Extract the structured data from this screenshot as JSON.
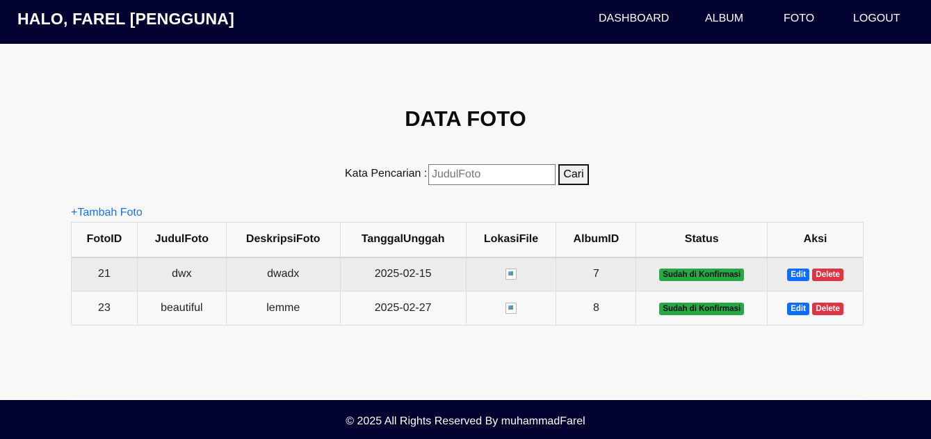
{
  "header": {
    "brand": "HALO, FAREL [PENGGUNA]",
    "nav": [
      {
        "label": "DASHBOARD"
      },
      {
        "label": "ALBUM"
      },
      {
        "label": "FOTO"
      },
      {
        "label": "LOGOUT"
      }
    ]
  },
  "main": {
    "title": "DATA FOTO",
    "search": {
      "label": "Kata Pencarian :",
      "placeholder": "JudulFoto",
      "value": "",
      "button": "Cari"
    },
    "add_link": "+Tambah Foto",
    "table": {
      "columns": [
        "FotoID",
        "JudulFoto",
        "DeskripsiFoto",
        "TanggalUnggah",
        "LokasiFile",
        "AlbumID",
        "Status",
        "Aksi"
      ],
      "rows": [
        {
          "fotoid": "21",
          "judul": "dwx",
          "deskripsi": "dwadx",
          "tanggal": "2025-02-15",
          "albumid": "7",
          "status": "Sudah di Konfirmasi",
          "edit": "Edit",
          "delete": "Delete"
        },
        {
          "fotoid": "23",
          "judul": "beautiful",
          "deskripsi": "lemme",
          "tanggal": "2025-02-27",
          "albumid": "8",
          "status": "Sudah di Konfirmasi",
          "edit": "Edit",
          "delete": "Delete"
        }
      ]
    }
  },
  "footer": {
    "text": "© 2025 All Rights Reserved By muhammadFarel"
  },
  "colors": {
    "navbar_bg": "#020230",
    "page_bg": "#f8f8f8",
    "link": "#1a73e8",
    "status_badge": "#28a745",
    "edit_button": "#0d6efd",
    "delete_button": "#dc3545"
  }
}
